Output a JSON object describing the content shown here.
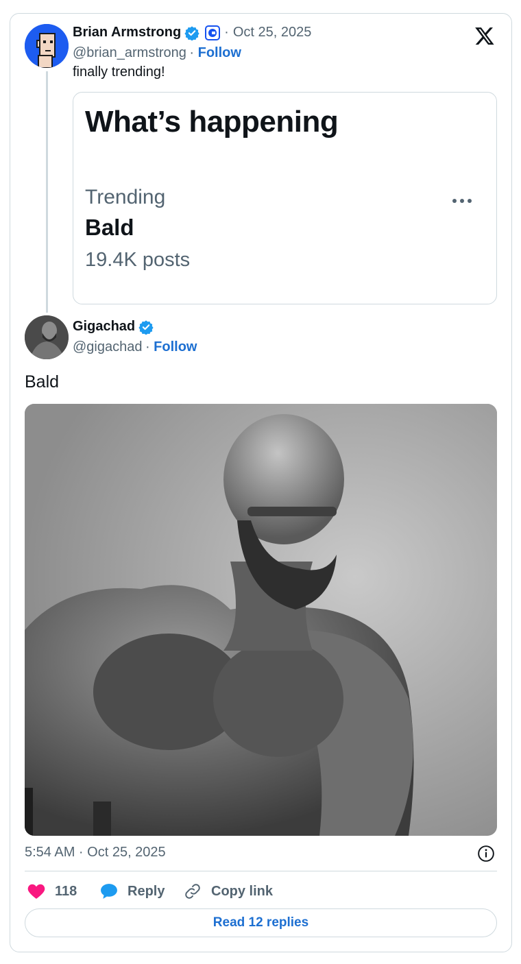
{
  "quoted_tweet": {
    "author_name": "Brian Armstrong",
    "date": "Oct 25, 2025",
    "handle": "@brian_armstrong",
    "follow_label": "Follow",
    "text": "finally trending!",
    "embed": {
      "title": "What’s happening",
      "label": "Trending",
      "topic": "Bald",
      "count": "19.4K posts"
    }
  },
  "main_tweet": {
    "author_name": "Gigachad",
    "handle": "@gigachad",
    "follow_label": "Follow",
    "text": "Bald",
    "timestamp": "5:54 AM · Oct 25, 2025"
  },
  "actions": {
    "like_count": "118",
    "reply_label": "Reply",
    "copy_label": "Copy link"
  },
  "read_replies_label": "Read 12 replies",
  "colors": {
    "link": "#1d6fd1",
    "verified": "#1d9bf0",
    "like": "#f91880",
    "text_secondary": "#536471",
    "border": "#cfd9de"
  }
}
